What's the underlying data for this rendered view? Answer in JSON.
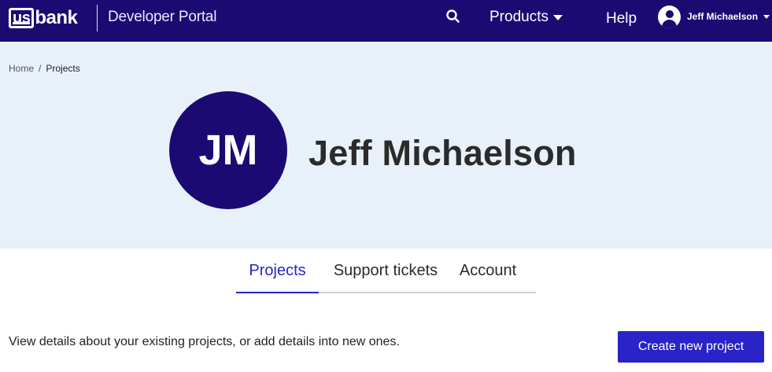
{
  "header": {
    "logo_us": "us",
    "logo_bank": "bank",
    "portal_title": "Developer Portal",
    "search_icon": "search-icon",
    "products_label": "Products",
    "help_label": "Help",
    "user_name": "Jeff Michaelson",
    "user_icon": "user-circle-icon"
  },
  "breadcrumb": {
    "home": "Home",
    "separator": "/",
    "current": "Projects"
  },
  "profile": {
    "initials": "JM",
    "name": "Jeff Michaelson"
  },
  "tabs": [
    {
      "label": "Projects",
      "active": true
    },
    {
      "label": "Support tickets",
      "active": false
    },
    {
      "label": "Account",
      "active": false
    }
  ],
  "main": {
    "description": "View details about your existing projects, or add details into new ones.",
    "create_button_label": "Create new project"
  },
  "colors": {
    "brand_navy": "#1c0a73",
    "accent_blue": "#2a23c9",
    "hero_bg": "#e8f1f9"
  }
}
